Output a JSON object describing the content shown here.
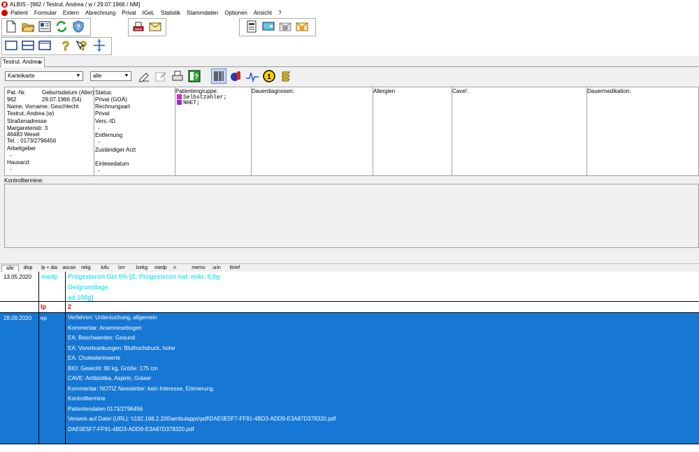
{
  "window": {
    "title": "ALBIS - [962 / Testrut, Andrea / w / 29.07.1966 / NM]"
  },
  "menu": [
    "Patient",
    "Formular",
    "Extern",
    "Abrechnung",
    "Privat",
    "IGeL",
    "Statistik",
    "Stammdaten",
    "Optionen",
    "Ansicht",
    "?"
  ],
  "toolbar": {
    "icons": [
      "new-document-icon",
      "open-folder-icon",
      "patient-card-icon",
      "refresh-icon",
      "shield-help-icon",
      "print-icon",
      "mail-icon",
      "notepad-icon",
      "monitor-icon",
      "mail-disabled-icon",
      "mail-locked-icon",
      "layout-single-icon",
      "layout-split-icon",
      "layout-wide-icon",
      "help-icon",
      "context-help-icon",
      "pin-icon"
    ]
  },
  "patient_tab": {
    "label": "Testrut. Andrea",
    "close": "✕"
  },
  "filters": {
    "view_combo": "Karteikarte",
    "scope_combo": "alle"
  },
  "patient": {
    "patnr_label": "Pat.-Nr.",
    "patnr": "962",
    "dob_label": "Geburtsdatum (Alter)",
    "dob": "29.07.1966 (54)",
    "name_label": "Name, Vorname, Geschlecht",
    "name": "Testrut, Andrea (w)",
    "street_label": "Straßenadresse",
    "street": "Margaretenstr. 3",
    "city": "46483 Wesel",
    "phone": "Tel. : 0173/2796456",
    "employer_label": "Arbeitgeber",
    "employer": "-",
    "gp_label": "Hausarzt",
    "gp": "-",
    "status_label": "Status:",
    "status": "Privat (GOÄ)",
    "billing_label": "Rechnungsart",
    "billing": "Privat",
    "insurance_label": "Vers.-ID.",
    "insurance": "-",
    "distance_label": "Entfernung",
    "distance": "-",
    "doctor_label": "Zuständiger Arzt",
    "readdate_label": "Einlesedatum",
    "readdate": "-"
  },
  "groups": {
    "label": "Patientengruppe:",
    "items": [
      {
        "text": "Selbstzahler;",
        "color": "#e01ecc"
      },
      {
        "text": "NHET;",
        "color": "#8a2be2"
      }
    ]
  },
  "columns": {
    "dauerdiagnosen": "Dauerdiagnosen:",
    "allergien": "Allergien",
    "cave": "Cave!:",
    "dauermedikation": "Dauermedikation:"
  },
  "kontrolltermine_label": "Kontrolltermine:",
  "list_tabs": [
    "alle",
    "disp",
    "lp + dia",
    "ascan",
    "rekg",
    "lufu",
    "lzrr",
    "lzekg",
    "medp",
    "n",
    "memo",
    "urin",
    "Brief"
  ],
  "entries": [
    {
      "date": "13.05.2020",
      "type": "medp",
      "lines": [
        "Progesteron Gel 5% [Z: Progesteron nat. mikr. 5,0g",
        "Gelgrundlage",
        "ad 100g]"
      ]
    },
    {
      "date": "",
      "type": "lp",
      "lines": [
        "2"
      ]
    },
    {
      "date": "28.09.2020",
      "type": "ep",
      "lines": [
        "Verfahren: Untersuchung, allgemein",
        "Kommentar: Anamnesebogen",
        "EA: Beschwerden: Gesund",
        "EA: Vorerkrankungen: Bluthochdruck, hohe",
        "EA: Cholesterinwerte",
        "BIO: Gewicht: 90 kg, Größe: 175 cm",
        "CAVE: Antibiotika, Aspirin, Gräser",
        "Kommentar:  NOTIZ Newsletter: kein Interesse, Erinnerung:",
        " Kontrolltermine",
        " Patientendaten 0173/2796456",
        "Verweis auf Datei (URL): \\\\192.168.2.200\\ambulapps\\pdf\\DAE0E5F7-FF91-4BD3-ADD9-E3A87D378320.pdf",
        " DAE0E5F7-FF91-4BD3-ADD9-E3A87D378320.pdf"
      ]
    }
  ],
  "colors": {
    "selection": "#1678d4",
    "medp": "#33e6ee",
    "lp": "#e40000"
  }
}
